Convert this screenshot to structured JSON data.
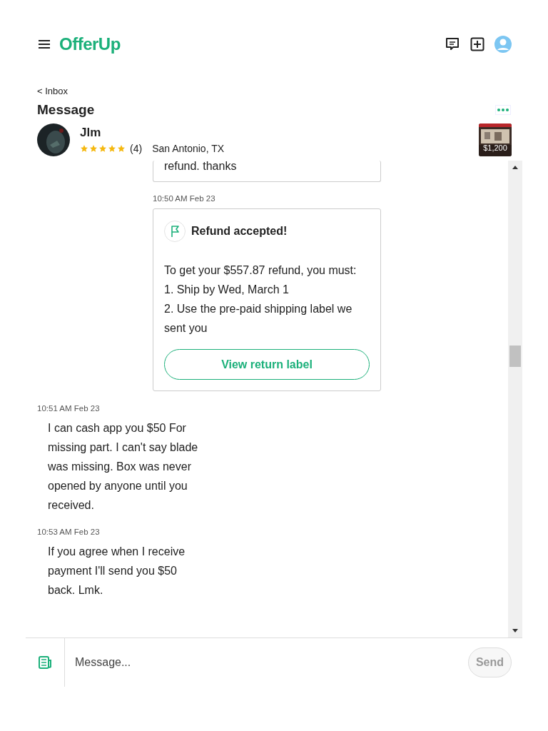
{
  "header": {
    "logo": "OfferUp"
  },
  "back_link": "< Inbox",
  "title": "Message",
  "contact": {
    "name": "Jlm",
    "stars": 5,
    "rating_count": "(4)",
    "location": "San Antonio, TX",
    "item_price": "$1,200"
  },
  "messages": [
    {
      "kind": "card",
      "text": "refund. thanks"
    },
    {
      "kind": "refund",
      "time": "10:50 AM Feb 23",
      "title": "Refund accepted!",
      "lines": [
        "To get your $557.87 refund, you must:",
        "1. Ship by Wed, March 1",
        "2. Use the pre-paid shipping label we sent you"
      ],
      "button": "View return label"
    },
    {
      "kind": "text",
      "time": "10:51 AM Feb 23",
      "text": "I can cash app you $50 For missing part. I can't say blade was missing. Box was never opened by anyone until you received."
    },
    {
      "kind": "text",
      "time": "10:53 AM Feb 23",
      "text": "If you agree when I receive payment I'll send you $50 back. Lmk."
    }
  ],
  "composer": {
    "placeholder": "Message...",
    "send": "Send",
    "send_disabled": true
  }
}
